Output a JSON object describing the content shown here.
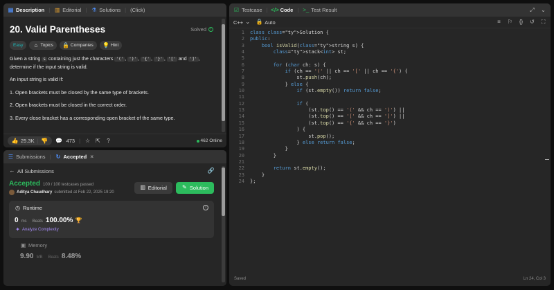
{
  "desc_tabs": [
    {
      "label": "Description",
      "icon": "document-icon"
    },
    {
      "label": "Editorial",
      "icon": "book-icon"
    },
    {
      "label": "Solutions",
      "icon": "flask-icon"
    },
    {
      "label": "(Click)",
      "icon": ""
    }
  ],
  "problem": {
    "title": "20. Valid Parentheses",
    "solved_label": "Solved",
    "chips": {
      "easy": "Easy",
      "topics": "Topics",
      "companies": "Companies",
      "hint": "Hint"
    },
    "p1_a": "Given a string ",
    "p1_code_s": "s",
    "p1_b": " containing just the characters ",
    "c1": "'('",
    "c2": "')'",
    "c3": "'{'",
    "c4": "'}'",
    "c5": "'['",
    "and": " and ",
    "c6": "']'",
    "p1_c": ", determine if the input string is valid.",
    "p2": "An input string is valid if:",
    "rules": [
      "1. Open brackets must be closed by the same type of brackets.",
      "2. Open brackets must be closed in the correct order.",
      "3. Every close bracket has a corresponding open bracket of the same type."
    ],
    "likes": "25.3K",
    "comments": "473",
    "online": "462 Online"
  },
  "sub_tabs": [
    {
      "label": "Submissions",
      "icon": "list-icon"
    },
    {
      "label": "Accepted",
      "icon": "refresh-icon"
    }
  ],
  "submission": {
    "back_label": "All Submissions",
    "status": "Accepted",
    "cases": "100 / 100 testcases passed",
    "author": "Aditya Chaudhary",
    "submitted": "submitted at Feb 22, 2025 19:20",
    "editorial_btn": "Editorial",
    "solution_btn": "Solution",
    "runtime_label": "Runtime",
    "runtime_value": "0",
    "runtime_unit": "ms",
    "beats_label": "Beats",
    "runtime_beats": "100.00%",
    "analyze_label": "Analyze Complexity",
    "memory_label": "Memory",
    "memory_value": "9.90",
    "memory_unit": "MB",
    "memory_beats": "8.48%"
  },
  "code_tabs": [
    {
      "label": "Testcase",
      "icon": "check-box-icon"
    },
    {
      "label": "Code",
      "icon": "code-icon"
    },
    {
      "label": "Test Result",
      "icon": "terminal-icon"
    }
  ],
  "editor": {
    "language": "C++",
    "mode": "Auto",
    "status_left": "Saved",
    "status_right": "Ln 24, Col 3"
  },
  "code_lines": [
    "class Solution {",
    "public:",
    "    bool isValid(string s) {",
    "        stack<int> st;",
    "",
    "        for (char ch: s) {",
    "            if (ch == '(' || ch == '[' || ch == '{') {",
    "                st.push(ch);",
    "            } else {",
    "                if (st.empty()) return false;",
    "",
    "                if (",
    "                    (st.top() == '(' && ch == ')') ||",
    "                    (st.top() == '[' && ch == ']') ||",
    "                    (st.top() == '{' && ch == '}')",
    "                ) {",
    "                    st.pop();",
    "                } else return false;",
    "            }",
    "        }",
    "",
    "        return st.empty();",
    "    }",
    "};"
  ]
}
